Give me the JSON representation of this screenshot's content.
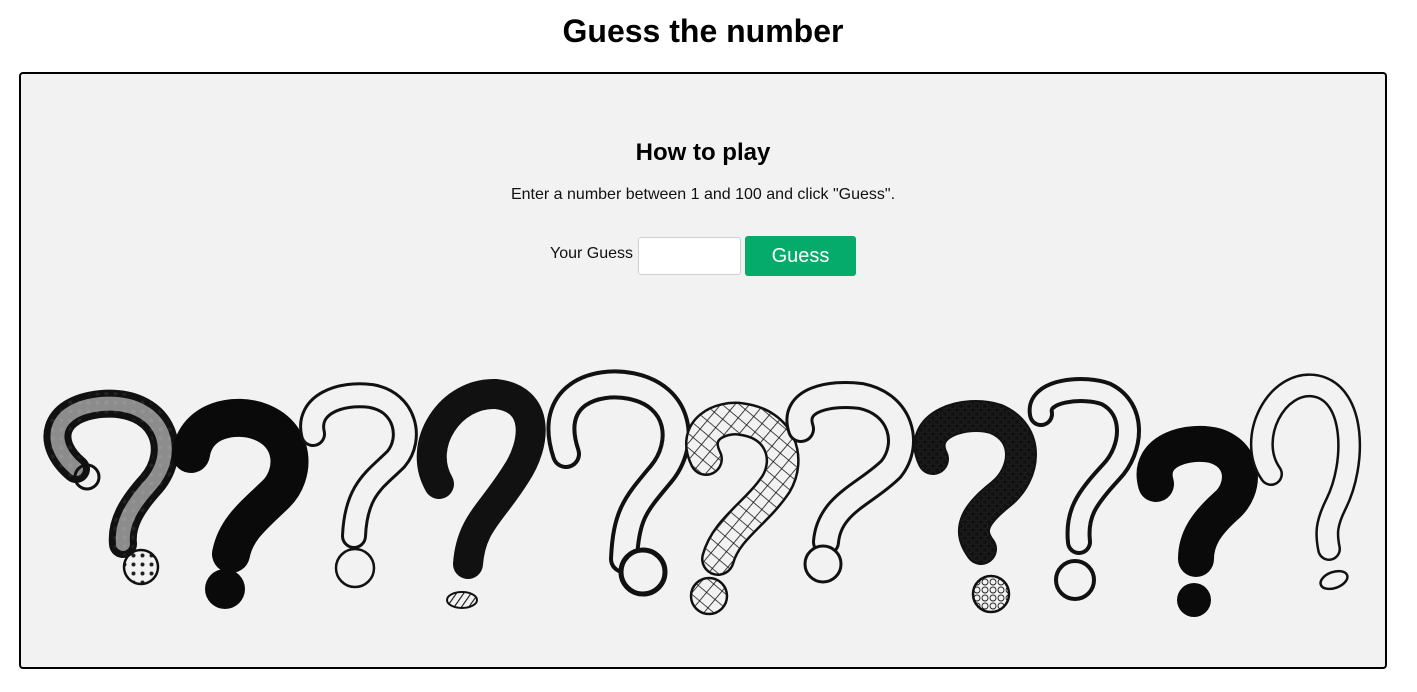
{
  "page": {
    "title": "Guess the number"
  },
  "game": {
    "howto_title": "How to play",
    "instructions": "Enter a number between 1 and 100 and click \"Guess\".",
    "guess_label": "Your Guess",
    "guess_input_value": "",
    "guess_input_placeholder": "",
    "guess_button_label": "Guess"
  },
  "colors": {
    "accent_button": "#05ab6b",
    "panel_background": "#f2f2f2",
    "panel_border": "#000000"
  },
  "illustration": {
    "icon": "question-marks-illustration",
    "count": 11
  }
}
